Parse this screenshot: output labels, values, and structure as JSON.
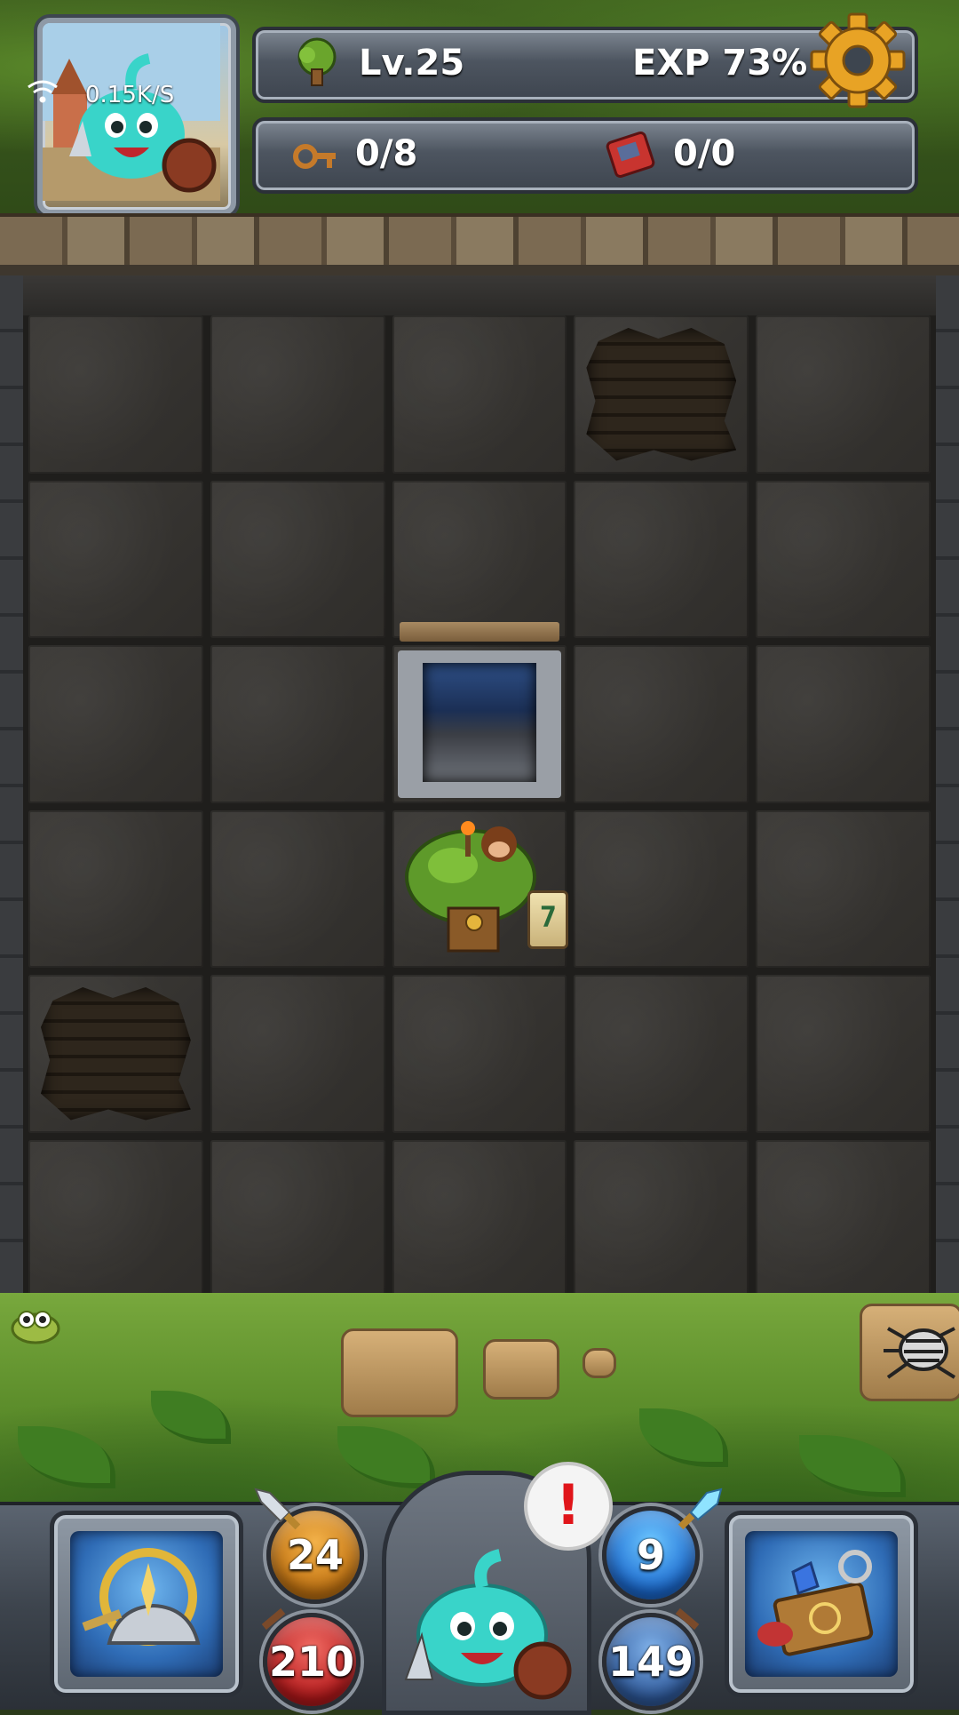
{
  "status": {
    "network_speed": "0.15K/S"
  },
  "hud": {
    "level": "Lv.25",
    "exp": "EXP 73%",
    "keys": "0/8",
    "scrolls": "0/0",
    "icons": {
      "level": "tree-icon",
      "keys": "key-icon",
      "scrolls": "spellbook-icon",
      "settings": "gear-icon"
    }
  },
  "board": {
    "rows": 6,
    "cols": 5,
    "timer_value": "7"
  },
  "bottom": {
    "attack": "24",
    "hp": "210",
    "defense": "9",
    "mp": "149",
    "alert": "!"
  },
  "colors": {
    "accent_gold": "#f0a52a",
    "hp_red": "#c1201f",
    "mana_blue": "#1b6ad1",
    "board_tile": "#36342f"
  }
}
